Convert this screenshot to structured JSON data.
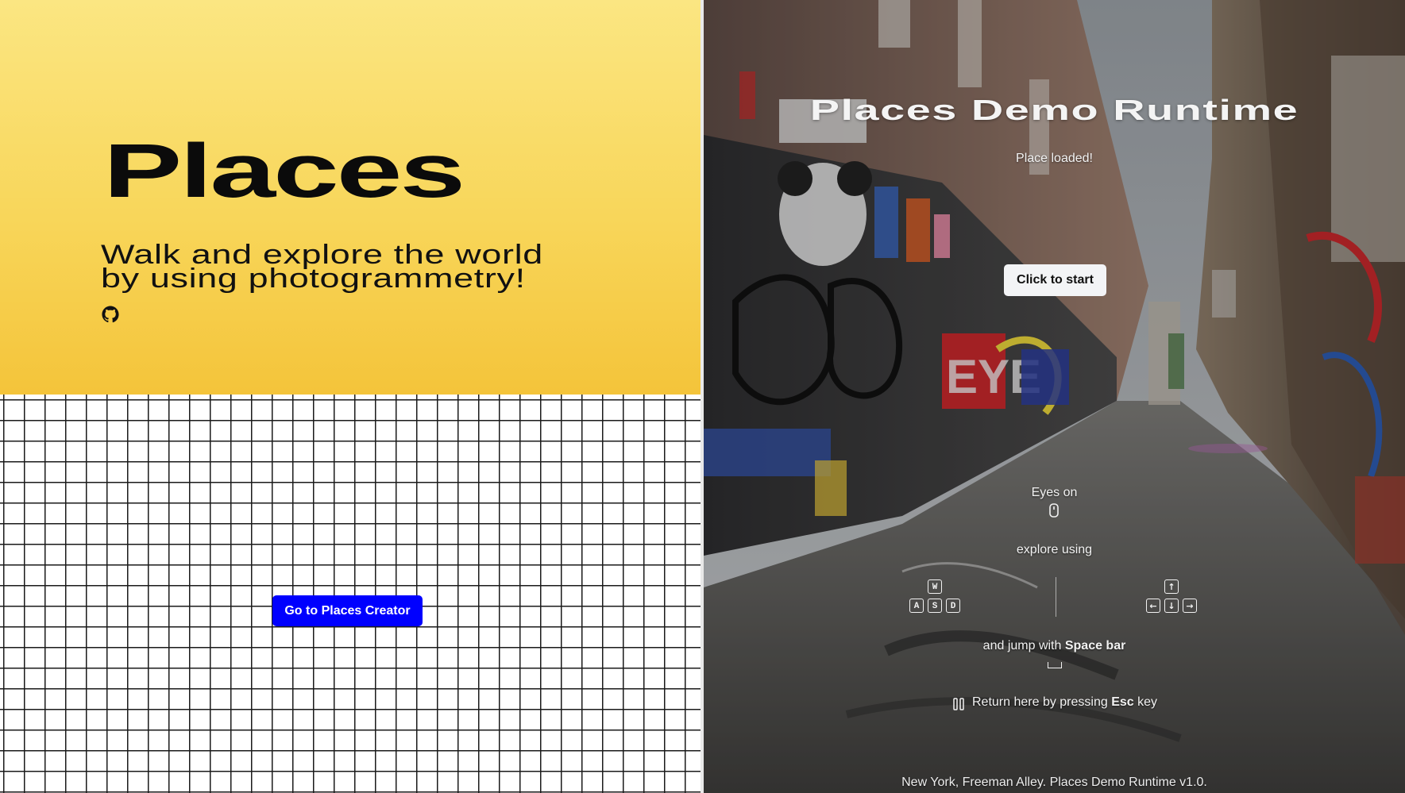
{
  "left": {
    "title": "Places",
    "subtitle_line1": "Walk and explore the world",
    "subtitle_line2": "by using photogrammetry!",
    "github_icon": "github-icon",
    "creator_button": "Go to Places Creator",
    "colors": {
      "hero_top": "#fbe682",
      "hero_bottom": "#f4c43a",
      "button": "#0000ff"
    }
  },
  "runtime": {
    "title": "Places Demo Runtime",
    "status": "Place loaded!",
    "start_button": "Click to start",
    "eyes_label": "Eyes on",
    "mouse_icon": "mouse-icon",
    "explore_label": "explore using",
    "wasd_keys": {
      "w": "W",
      "a": "A",
      "s": "S",
      "d": "D"
    },
    "arrow_keys": {
      "up": "↑",
      "left": "←",
      "down": "↓",
      "right": "→"
    },
    "jump_prefix": "and jump with",
    "jump_key": "Space bar",
    "return_prefix": "Return here by pressing",
    "return_key": "Esc",
    "return_suffix": "key",
    "pause_icon": "pause-icon",
    "footer": "New York, Freeman Alley. Places Demo Runtime v1.0."
  }
}
